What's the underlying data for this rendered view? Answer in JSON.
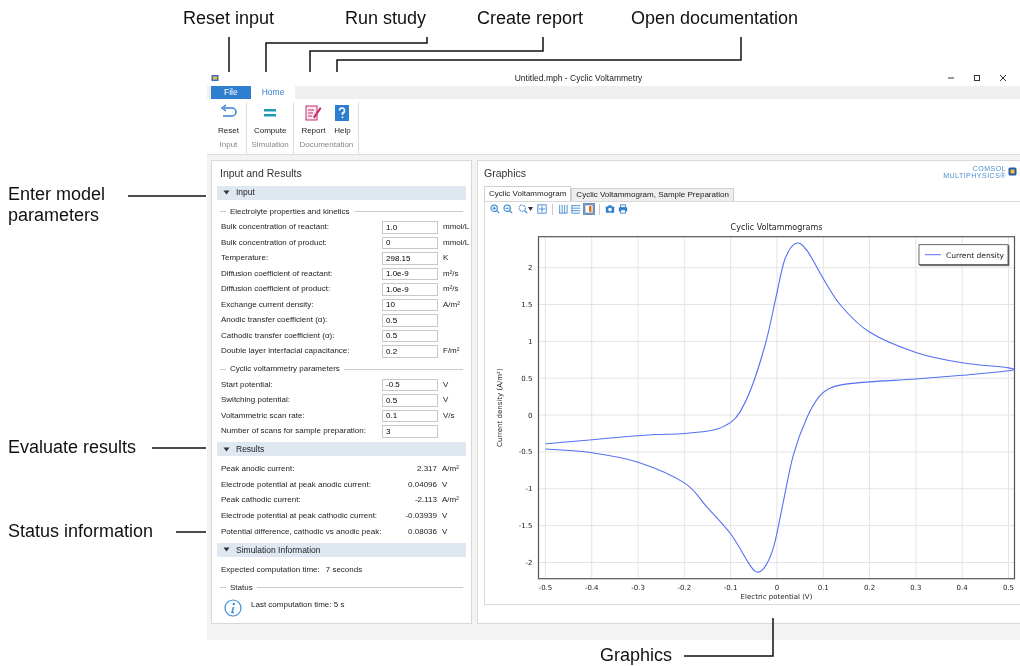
{
  "callouts": [
    {
      "text": "Reset input"
    },
    {
      "text": "Run study"
    },
    {
      "text": "Create report"
    },
    {
      "text": "Open documentation"
    },
    {
      "text": "Enter model parameters"
    },
    {
      "text": "Evaluate results"
    },
    {
      "text": "Status information"
    },
    {
      "text": "Graphics"
    }
  ],
  "window": {
    "title": "Untitled.mph - Cyclic Voltammetry"
  },
  "ribbon": {
    "tabs": [
      {
        "label": "File",
        "kind": "file",
        "selected": false
      },
      {
        "label": "Home",
        "kind": "tab",
        "selected": true
      }
    ],
    "groups": [
      {
        "label": "Input",
        "buttons": [
          {
            "label": "Reset",
            "kind": "reset"
          }
        ]
      },
      {
        "label": "Simulation",
        "buttons": [
          {
            "label": "Compute",
            "kind": "compute"
          }
        ]
      },
      {
        "label": "Documentation",
        "buttons": [
          {
            "label": "Report",
            "kind": "report"
          },
          {
            "label": "Help",
            "kind": "help"
          }
        ]
      }
    ]
  },
  "input_panel": {
    "title": "Input and Results",
    "sections": [
      {
        "title": "Input",
        "kind": "inputs",
        "expanded": true,
        "groups": [
          {
            "legend": "Electrolyte properties and kinetics",
            "rows": [
              {
                "label": "Bulk concentration of reactant:",
                "value": "1.0",
                "unit": "mmol/L"
              },
              {
                "label": "Bulk concentration of product:",
                "value": "0",
                "unit": "mmol/L"
              },
              {
                "label": "Temperature:",
                "value": "298.15",
                "unit": "K"
              },
              {
                "label": "Diffusion coefficient of reactant:",
                "value": "1.0e-9",
                "unit": "m²/s"
              },
              {
                "label": "Diffusion coefficient of product:",
                "value": "1.0e-9",
                "unit": "m²/s"
              },
              {
                "label": "Exchange current density:",
                "value": "10",
                "unit": "A/m²"
              },
              {
                "label": "Anodic transfer coefficient (α):",
                "value": "0.5"
              },
              {
                "label": "Cathodic transfer coefficient (α):",
                "value": "0.5"
              },
              {
                "label": "Double layer interfacial capacitance:",
                "value": "0.2",
                "unit": "F/m²"
              }
            ]
          },
          {
            "legend": "Cyclic voltammetry parameters",
            "rows": [
              {
                "label": "Start potential:",
                "value": "-0.5",
                "unit": "V"
              },
              {
                "label": "Switching potential:",
                "value": "0.5",
                "unit": "V"
              },
              {
                "label": "Voltammetric scan rate:",
                "value": "0.1",
                "unit": "V/s"
              },
              {
                "label": "Number of scans for sample preparation:",
                "value": "3"
              }
            ]
          }
        ]
      },
      {
        "title": "Results",
        "kind": "results",
        "expanded": true,
        "rows": [
          {
            "label": "Peak anodic current:",
            "value": "2.317",
            "unit": "A/m²"
          },
          {
            "label": "Electrode potential at peak anodic current:",
            "value": "0.04096",
            "unit": "V"
          },
          {
            "label": "Peak cathodic current:",
            "value": "-2.113",
            "unit": "A/m²"
          },
          {
            "label": "Electrode potential at peak cathodic current:",
            "value": "-0.03939",
            "unit": "V"
          },
          {
            "label": "Potential difference, cathodic vs anodic peak:",
            "value": "0.08036",
            "unit": "V"
          }
        ]
      },
      {
        "title": "Simulation Information",
        "kind": "info",
        "expanded": true,
        "expected": {
          "label": "Expected computation time:",
          "value": "7 seconds"
        },
        "status": {
          "legend": "Status",
          "message": "Last computation time: 5 s"
        }
      }
    ]
  },
  "graphics": {
    "title": "Graphics",
    "logo": {
      "line1": "COMSOL",
      "line2": "MULTIPHYSICS®"
    },
    "tabs": [
      {
        "label": "Cyclic Voltammogram",
        "selected": true
      },
      {
        "label": "Cyclic Voltammogram, Sample Preparation",
        "selected": false
      }
    ],
    "toolbar": [
      [
        {
          "kind": "zoom-in",
          "selected": false
        },
        {
          "kind": "zoom-out",
          "selected": false
        },
        {
          "kind": "zoom-box",
          "selected": false
        },
        {
          "kind": "zoom-extents",
          "selected": false
        }
      ],
      [
        {
          "kind": "grid-x",
          "selected": false
        },
        {
          "kind": "grid-y",
          "selected": false
        },
        {
          "kind": "legend",
          "selected": true
        }
      ],
      [
        {
          "kind": "camera",
          "selected": false
        },
        {
          "kind": "print",
          "selected": false
        }
      ]
    ],
    "chart_data": {
      "type": "line",
      "title": "Cyclic Voltammograms",
      "xlabel": "Electric potential (V)",
      "ylabel": "Current density (A/m²)",
      "x": [
        -0.5,
        -0.3,
        -0.2,
        -0.135,
        -0.1,
        -0.08,
        -0.054,
        -0.024,
        -0.002,
        0.017,
        0.041,
        0.065,
        0.102,
        0.139,
        0.199,
        0.3,
        0.4,
        0.5,
        0.5,
        0.4,
        0.3,
        0.2,
        0.139,
        0.113,
        0.091,
        0.065,
        0.035,
        0.013,
        -0.006,
        -0.024,
        -0.041,
        -0.058,
        -0.099,
        -0.151,
        -0.2,
        -0.3,
        -0.4,
        -0.5
      ],
      "series": [
        {
          "name": "Current density",
          "color": "#5470f0",
          "values": [
            -0.39,
            -0.28,
            -0.25,
            -0.2,
            -0.1,
            0.04,
            0.39,
            0.99,
            1.6,
            2.11,
            2.33,
            2.23,
            1.83,
            1.48,
            1.13,
            0.85,
            0.71,
            0.64,
            0.6,
            0.54,
            0.49,
            0.45,
            0.41,
            0.36,
            0.25,
            -0.03,
            -0.55,
            -1.2,
            -1.76,
            -2.04,
            -2.13,
            -2.04,
            -1.62,
            -1.25,
            -0.92,
            -0.64,
            -0.51,
            -0.46
          ]
        }
      ],
      "grid": true,
      "xlim": [
        -0.515,
        0.513
      ],
      "ylim": [
        -2.22,
        2.42
      ],
      "xticks": [
        -0.5,
        -0.4,
        -0.3,
        -0.2,
        -0.1,
        0,
        0.1,
        0.2,
        0.3,
        0.4,
        0.5
      ],
      "yticks": [
        -2,
        -1.5,
        -1,
        -0.5,
        0,
        0.5,
        1,
        1.5,
        2
      ]
    }
  }
}
